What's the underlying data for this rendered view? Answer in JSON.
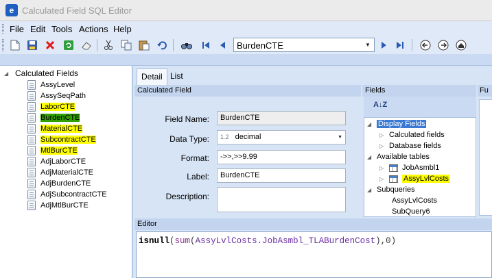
{
  "window": {
    "title": "Calculated Field SQL Editor",
    "app_icon_letter": "e"
  },
  "menu": [
    "File",
    "Edit",
    "Tools",
    "Actions",
    "Help"
  ],
  "toolbar": {
    "icons": [
      "new-icon",
      "save-icon",
      "delete-icon",
      "refresh-icon",
      "eraser-icon",
      "cut-icon",
      "copy-icon",
      "paste-icon",
      "undo-icon",
      "find-icon",
      "first-record-icon",
      "previous-record-icon",
      "next-record-icon",
      "back-icon",
      "forward-icon",
      "home-icon"
    ],
    "combo_value": "BurdenCTE"
  },
  "tree": {
    "root_label": "Calculated Fields",
    "items": [
      {
        "label": "AssyLevel",
        "highlight": "none"
      },
      {
        "label": "AssySeqPath",
        "highlight": "none"
      },
      {
        "label": "LaborCTE",
        "highlight": "yellow"
      },
      {
        "label": "BurdenCTE",
        "highlight": "green"
      },
      {
        "label": "MaterialCTE",
        "highlight": "yellow"
      },
      {
        "label": "SubcontractCTE",
        "highlight": "yellow"
      },
      {
        "label": "MtlBurCTE",
        "highlight": "yellow"
      },
      {
        "label": "AdjLaborCTE",
        "highlight": "none"
      },
      {
        "label": "AdjMaterialCTE",
        "highlight": "none"
      },
      {
        "label": "AdjBurdenCTE",
        "highlight": "none"
      },
      {
        "label": "AdjSubcontractCTE",
        "highlight": "none"
      },
      {
        "label": "AdjMtlBurCTE",
        "highlight": "none"
      }
    ]
  },
  "tabs": {
    "detail": "Detail",
    "list": "List"
  },
  "calculated_field": {
    "header": "Calculated Field",
    "field_name_label": "Field Name:",
    "field_name_value": "BurdenCTE",
    "data_type_label": "Data Type:",
    "data_type_prefix": "1.2",
    "data_type_value": "decimal",
    "format_label": "Format:",
    "format_value": "->>,>>9.99",
    "label_label": "Label:",
    "label_value": "BurdenCTE",
    "description_label": "Description:",
    "description_value": ""
  },
  "fields_panel": {
    "header": "Fields",
    "sort_label": "A↓Z",
    "display_fields": "Display Fields",
    "calculated_fields": "Calculated fields",
    "database_fields": "Database fields",
    "available_tables": "Available tables",
    "table_1": "JobAsmbl1",
    "table_2": "AssyLvlCosts",
    "subqueries": "Subqueries",
    "subquery_1": "AssyLvlCosts",
    "subquery_2": "SubQuery6"
  },
  "functions_panel": {
    "header": "Fu"
  },
  "editor": {
    "header": "Editor",
    "code_isnull": "isnull",
    "code_open1": "(",
    "code_sum": "sum",
    "code_open2": "(",
    "code_arg": "AssyLvlCosts.JobAsmbl_TLABurdenCost",
    "code_close": "),0)"
  }
}
